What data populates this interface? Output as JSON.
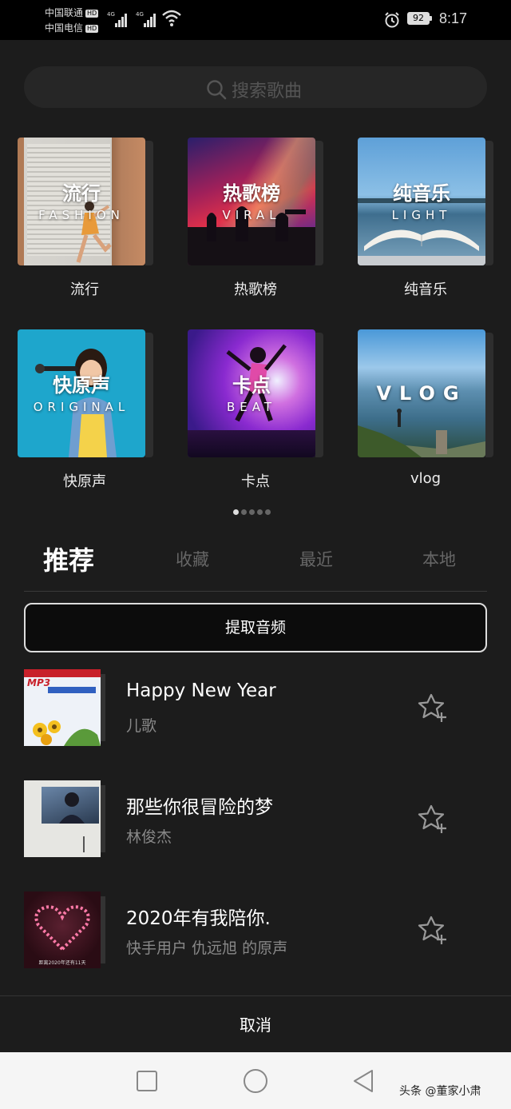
{
  "status_bar": {
    "carrier1": "中国联通",
    "carrier2": "中国电信",
    "hd_badge": "HD",
    "network1": "4G",
    "network2": "4G",
    "battery": "92",
    "time": "8:17"
  },
  "search": {
    "placeholder": "搜索歌曲"
  },
  "categories": [
    {
      "name": "流行",
      "cover_title": "流行",
      "cover_sub": "FASHION"
    },
    {
      "name": "热歌榜",
      "cover_title": "热歌榜",
      "cover_sub": "VIRAL"
    },
    {
      "name": "纯音乐",
      "cover_title": "纯音乐",
      "cover_sub": "LIGHT"
    },
    {
      "name": "快原声",
      "cover_title": "快原声",
      "cover_sub": "ORIGINAL"
    },
    {
      "name": "卡点",
      "cover_title": "卡点",
      "cover_sub": "BEAT"
    },
    {
      "name": "vlog",
      "cover_title": "VLOG",
      "cover_sub": ""
    }
  ],
  "pager": {
    "pages": 5,
    "active": 1
  },
  "tabs": [
    {
      "label": "推荐",
      "active": true
    },
    {
      "label": "收藏",
      "active": false
    },
    {
      "label": "最近",
      "active": false
    },
    {
      "label": "本地",
      "active": false
    }
  ],
  "extract_button": "提取音频",
  "songs": [
    {
      "title": "Happy New Year",
      "artist": "儿歌",
      "art_text": "MP3"
    },
    {
      "title": "那些你很冒险的梦",
      "artist": "林俊杰"
    },
    {
      "title": "2020年有我陪你.",
      "artist": "快手用户 仇远旭 的原声",
      "art_text": "距离2020年还有11天"
    }
  ],
  "cancel_button": "取消",
  "watermark": "头条 @董家小肃",
  "colors": {
    "background": "#1c1c1c",
    "statusbar": "#000000",
    "navbar": "#f5f5f5",
    "muted_text": "#888888"
  }
}
